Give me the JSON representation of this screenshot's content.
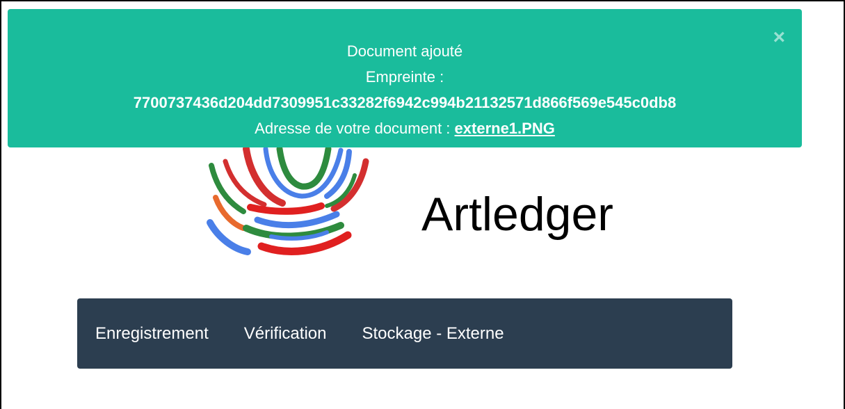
{
  "alert": {
    "title": "Document ajouté",
    "fingerprint_label": "Empreinte :",
    "fingerprint_value": "7700737436d204dd7309951c33282f6942c994b21132571d866f569e545c0db8",
    "address_label": "Adresse de votre document : ",
    "address_link": "externe1.PNG",
    "close_symbol": "×",
    "color": "#1abc9c"
  },
  "brand": {
    "name": "Artledger",
    "logo_colors": [
      "#d32f2f",
      "#2e8b3e",
      "#4a7fe8",
      "#e86a2e",
      "#e02020"
    ]
  },
  "navbar": {
    "color": "#2c3e50",
    "items": [
      {
        "label": "Enregistrement"
      },
      {
        "label": "Vérification"
      },
      {
        "label": "Stockage - Externe"
      }
    ]
  }
}
